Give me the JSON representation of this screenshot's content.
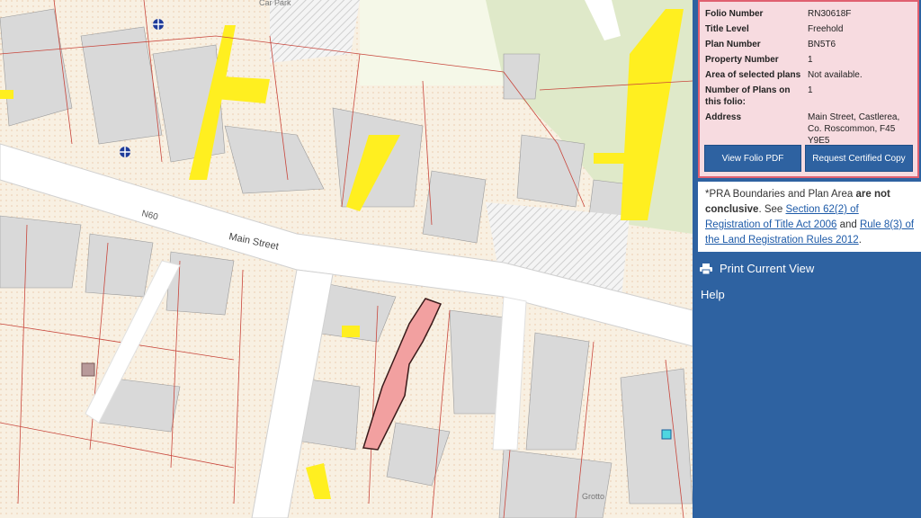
{
  "map": {
    "labels": {
      "car_park": "Car Park",
      "road_code": "N60",
      "street": "Main Street",
      "grotto": "Grotto"
    }
  },
  "folio": {
    "rows": [
      {
        "key": "Folio Number",
        "value": "RN30618F"
      },
      {
        "key": "Title Level",
        "value": "Freehold"
      },
      {
        "key": "Plan Number",
        "value": "BN5T6"
      },
      {
        "key": "Property Number",
        "value": "1"
      },
      {
        "key": "Area of selected plans",
        "value": "Not available."
      },
      {
        "key": "Number of Plans on this folio:",
        "value": "1"
      },
      {
        "key": "Address",
        "value": "Main Street, Castlerea, Co. Roscommon, F45 Y9E5"
      }
    ],
    "buttons": {
      "view_pdf": "View Folio PDF",
      "request_copy": "Request Certified Copy"
    }
  },
  "note": {
    "prefix": "*PRA Boundaries and Plan Area ",
    "bold": "are not conclusive",
    "mid": ". See ",
    "link1": "Section 62(2) of Registration of Title Act 2006",
    "and": " and ",
    "link2": "Rule 8(3) of the Land Registration Rules 2012",
    "end": "."
  },
  "menu": {
    "print": "Print Current View",
    "help": "Help"
  },
  "colors": {
    "panel": "#2e62a1",
    "selected_plan": "#f2a0a0",
    "highlight": "#ffef20",
    "building": "#d9d9d9",
    "boundary": "#c8463c"
  }
}
